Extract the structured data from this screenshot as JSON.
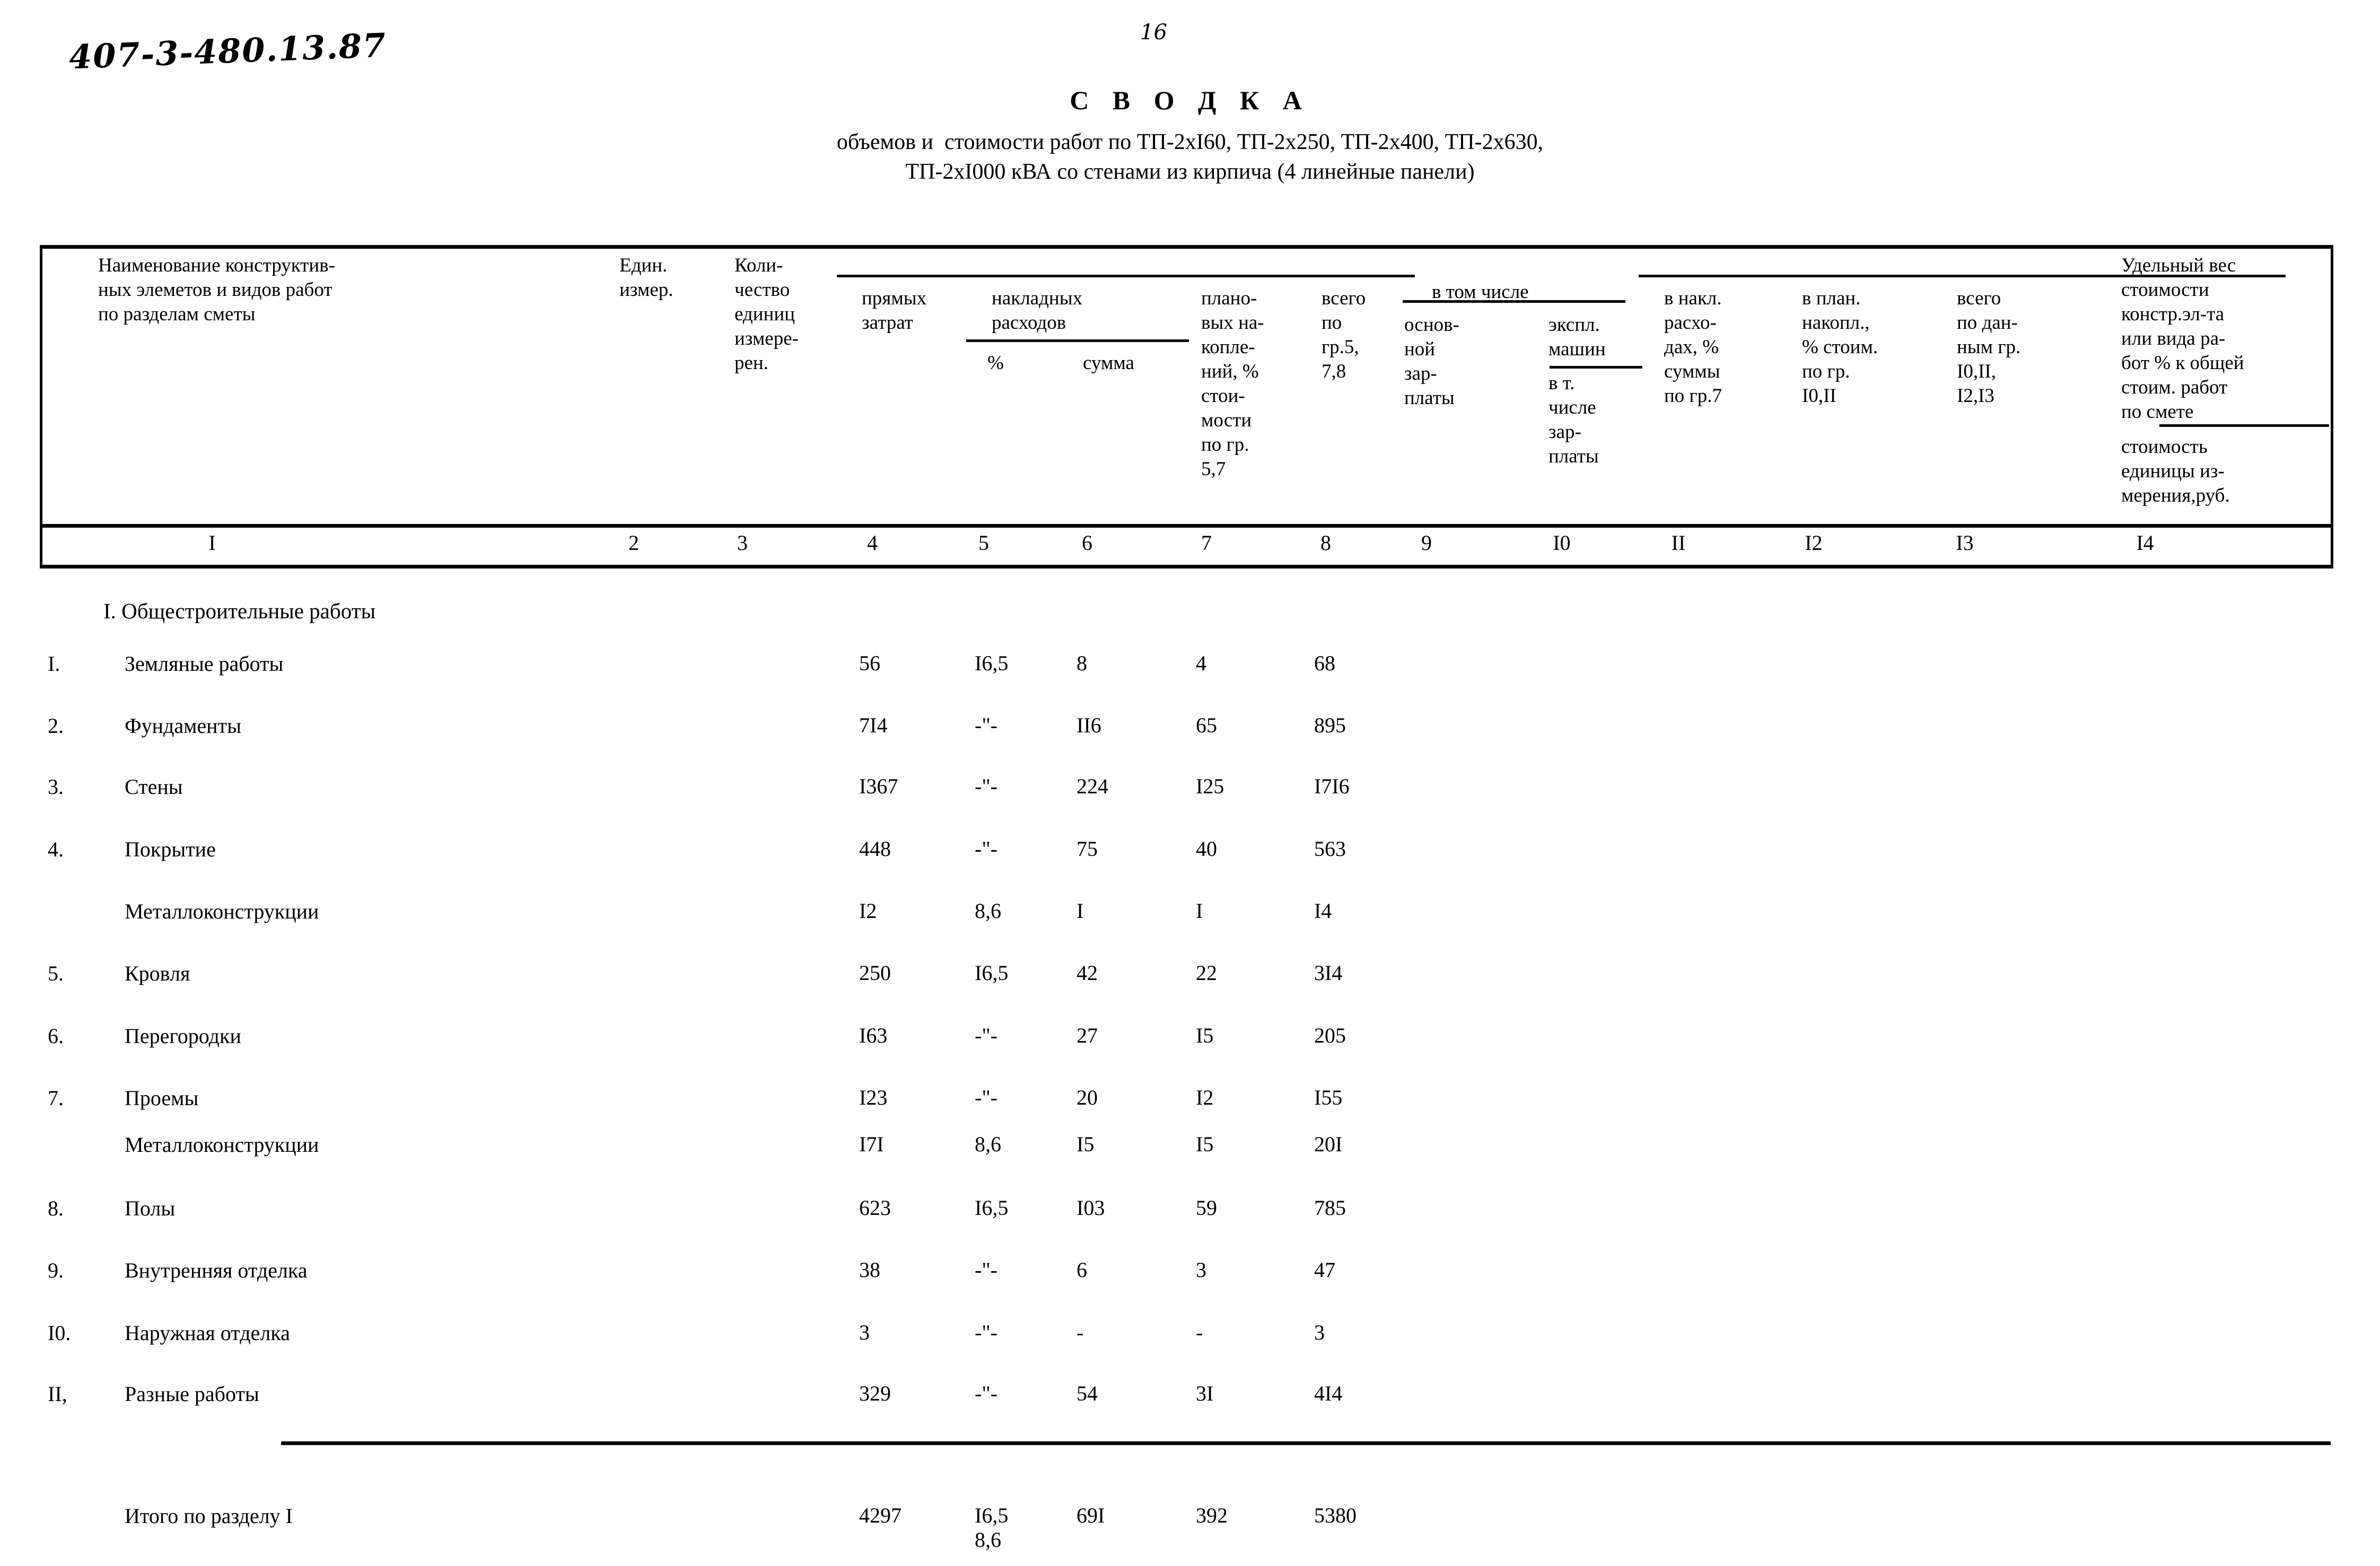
{
  "document": {
    "code": "407-3-480.13.87",
    "page_number": "16",
    "title": "С В О Д К А",
    "subtitle_line1": "объемов и  стоимости работ по ТП-2хI60, ТП-2х250, ТП-2х400, ТП-2х630,",
    "subtitle_line2": "ТП-2хI000 кВА со стенами из кирпича (4 линейные панели)"
  },
  "table": {
    "headers": {
      "col1": "Наименование конструктив-\nных элеметов и видов работ\nпо разделам сметы",
      "col2": "Един.\nизмер.",
      "col3": "Коли-\nчество\nединиц\nизмере-\nрен.",
      "col4": "прямых\nзатрат",
      "group_overheads": "накладных\nрасходов",
      "col5": "%",
      "col6": "сумма",
      "col7": "плано-\nвых на-\nкопле-\nний, %\nстои-\nмости\nпо гр.\n5,7",
      "col8": "всего\nпо\nгр.5,\n7,8",
      "group_including": "в том числе",
      "col9": "основ-\nной\nзар-\nплаты",
      "col10_top": "экспл.\nмашин",
      "col10_bottom": "в т.\nчисле\nзар-\nплаты",
      "col11": "в накл.\nрасхо-\nдах, %\nсуммы\nпо гр.7",
      "col12": "в план.\nнакопл.,\n% стоим.\nпо гр.\nI0,II",
      "col13": "всего\nпо дан-\nным гр.\nI0,II,\nI2,I3",
      "col14_top": "Удельный вес\nстоимости\nконстр.эл-та\nили вида ра-\nбот % к общей\nстоим. работ\nпо смете",
      "col14_bottom": "стоимость\nединицы из-\nмерения,руб."
    },
    "column_numbers": [
      "I",
      "2",
      "3",
      "4",
      "5",
      "6",
      "7",
      "8",
      "9",
      "I0",
      "II",
      "I2",
      "I3",
      "I4"
    ],
    "section_heading": "I. Общестроительные работы",
    "rows": [
      {
        "idx": "I.",
        "label": "Земляные работы",
        "c4": "56",
        "c5": "I6,5",
        "c6": "8",
        "c7": "4",
        "c8": "68"
      },
      {
        "idx": "2.",
        "label": "Фундаменты",
        "c4": "7I4",
        "c5": "-\"-",
        "c6": "II6",
        "c7": "65",
        "c8": "895"
      },
      {
        "idx": "3.",
        "label": "Стены",
        "c4": "I367",
        "c5": "-\"-",
        "c6": "224",
        "c7": "I25",
        "c8": "I7I6"
      },
      {
        "idx": "4.",
        "label": "Покрытие",
        "c4": "448",
        "c5": "-\"-",
        "c6": "75",
        "c7": "40",
        "c8": "563"
      },
      {
        "idx": "",
        "label": "Металлоконструкции",
        "c4": "I2",
        "c5": "8,6",
        "c6": "I",
        "c7": "I",
        "c8": "I4"
      },
      {
        "idx": "5.",
        "label": "Кровля",
        "c4": "250",
        "c5": "I6,5",
        "c6": "42",
        "c7": "22",
        "c8": "3I4"
      },
      {
        "idx": "6.",
        "label": "Перегородки",
        "c4": "I63",
        "c5": "-\"-",
        "c6": "27",
        "c7": "I5",
        "c8": "205"
      },
      {
        "idx": "7.",
        "label": "Проемы",
        "c4": "I23",
        "c5": "-\"-",
        "c6": "20",
        "c7": "I2",
        "c8": "I55"
      },
      {
        "idx": "",
        "label": "Металлоконструкции",
        "c4": "I7I",
        "c5": "8,6",
        "c6": "I5",
        "c7": "I5",
        "c8": "20I"
      },
      {
        "idx": "8.",
        "label": "Полы",
        "c4": "623",
        "c5": "I6,5",
        "c6": "I03",
        "c7": "59",
        "c8": "785"
      },
      {
        "idx": "9.",
        "label": "Внутренняя отделка",
        "c4": "38",
        "c5": "-\"-",
        "c6": "6",
        "c7": "3",
        "c8": "47"
      },
      {
        "idx": "I0.",
        "label": "Наружная отделка",
        "c4": "3",
        "c5": "-\"-",
        "c6": "-",
        "c7": "-",
        "c8": "3"
      },
      {
        "idx": "II,",
        "label": "Разные работы",
        "c4": "329",
        "c5": "-\"-",
        "c6": "54",
        "c7": "3I",
        "c8": "4I4"
      }
    ],
    "total_row": {
      "label": "Итого по разделу I",
      "c4": "4297",
      "c5": "I6,5\n8,6",
      "c6": "69I",
      "c7": "392",
      "c8": "5380"
    }
  }
}
